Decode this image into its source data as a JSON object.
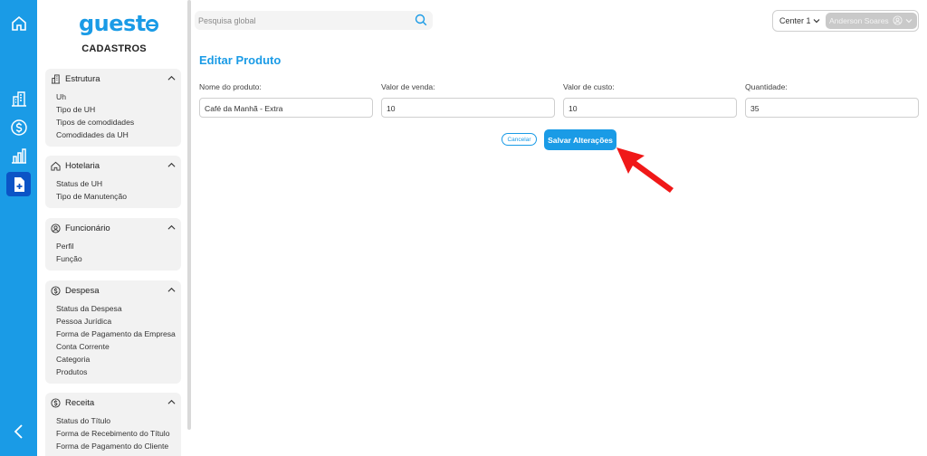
{
  "brand": {
    "logo_text": "guest",
    "accent": "#1a9be6",
    "rail_active": "#0b54c6"
  },
  "rail": {
    "items": [
      {
        "name": "home-icon"
      },
      {
        "name": "building-icon"
      },
      {
        "name": "dollar-icon"
      },
      {
        "name": "bar-chart-icon"
      },
      {
        "name": "document-add-icon"
      }
    ],
    "collapse": "chevron-left-icon"
  },
  "sidebar": {
    "title": "CADASTROS",
    "groups": [
      {
        "label": "Estrutura",
        "icon": "building-icon",
        "items": [
          "Uh",
          "Tipo de UH",
          "Tipos de comodidades",
          "Comodidades da UH"
        ]
      },
      {
        "label": "Hotelaria",
        "icon": "home-icon",
        "items": [
          "Status de UH",
          "Tipo de Manutenção"
        ]
      },
      {
        "label": "Funcionário",
        "icon": "user-circle-icon",
        "items": [
          "Perfil",
          "Função"
        ]
      },
      {
        "label": "Despesa",
        "icon": "dollar-circle-icon",
        "items": [
          "Status da Despesa",
          "Pessoa Jurídica",
          "Forma de Pagamento da Empresa",
          "Conta Corrente",
          "Categoria",
          "Produtos"
        ]
      },
      {
        "label": "Receita",
        "icon": "dollar-circle-icon",
        "items": [
          "Status do Título",
          "Forma de Recebimento do Título",
          "Forma de Pagamento do Cliente"
        ]
      }
    ]
  },
  "topbar": {
    "search_placeholder": "Pesquisa global",
    "center": "Center 1",
    "user": "Anderson Soares"
  },
  "main": {
    "title": "Editar Produto",
    "fields": [
      {
        "label": "Nome do produto:",
        "value": "Café da Manhã - Extra"
      },
      {
        "label": "Valor de venda:",
        "value": "10"
      },
      {
        "label": "Valor de custo:",
        "value": "10"
      },
      {
        "label": "Quantidade:",
        "value": "35"
      }
    ],
    "cancel_label": "Cancelar",
    "save_label": "Salvar Alterações"
  },
  "annotation": {
    "color": "#f01818"
  }
}
